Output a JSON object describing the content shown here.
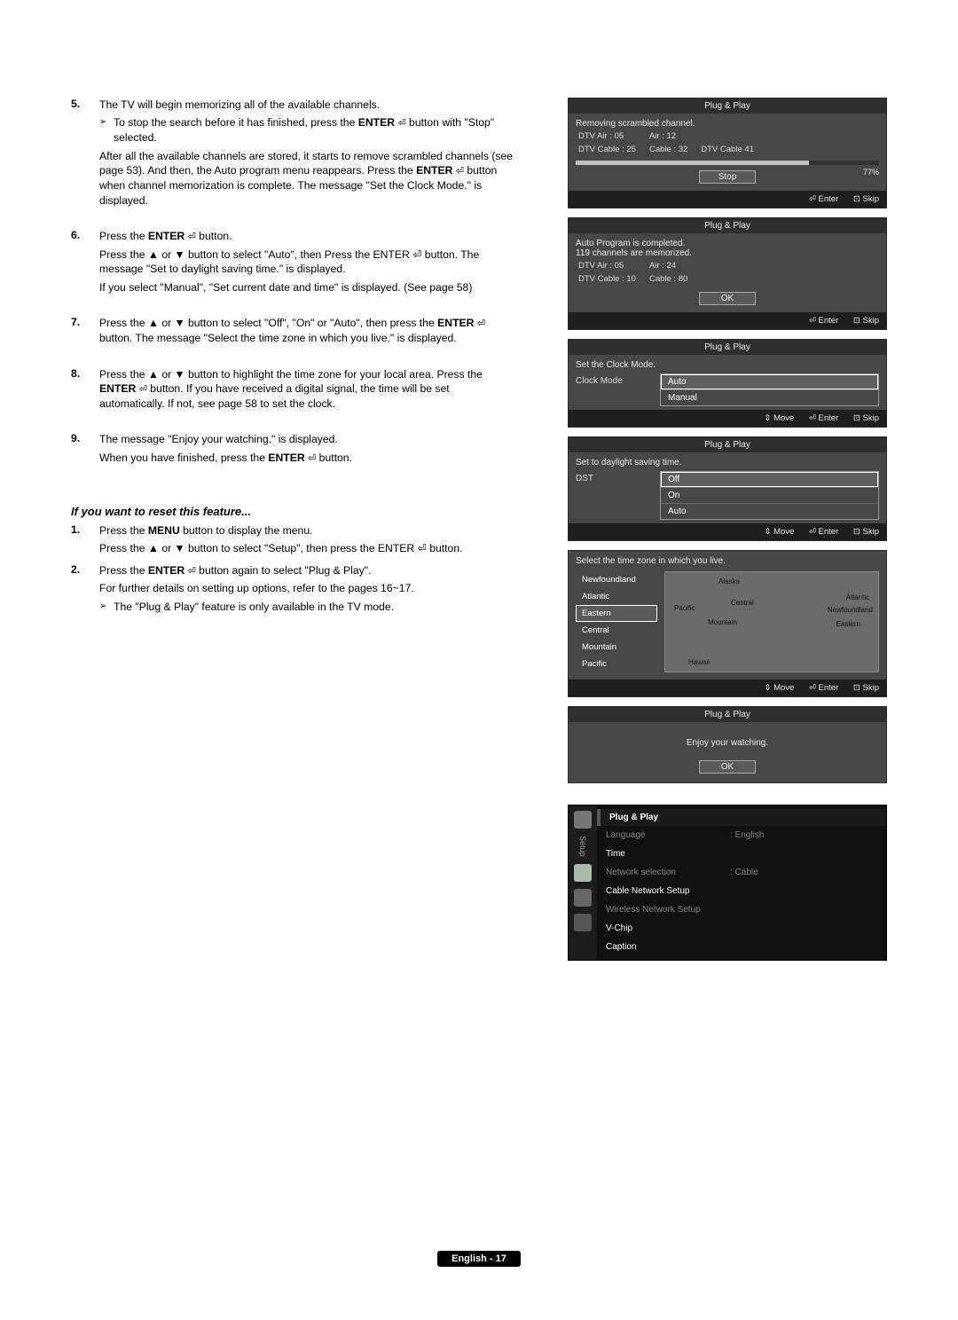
{
  "steps": {
    "s5": {
      "num": "5.",
      "p1a": "The TV will begin memorizing all of the available channels.",
      "note1a": "To stop the search before it has finished, press the ",
      "note1b": "ENTER",
      "note1c": " button with \"Stop\" selected.",
      "p2a": "After all the available channels are stored, it starts to remove scrambled channels (see page 53). And then, the Auto program menu reappears. Press the ",
      "p2b": "ENTER",
      "p2c": " button when channel memorization is complete. The message \"Set the Clock Mode.\" is displayed."
    },
    "s6": {
      "num": "6.",
      "p1a": "Press the ",
      "p1b": "ENTER",
      "p1c": " button.",
      "p2": "Press the ▲ or ▼ button to select \"Auto\", then Press the ENTER ⏎ button. The message \"Set to daylight saving time.\" is displayed.",
      "p3": "If you select \"Manual\", \"Set current date and time\" is displayed. (See page 58)"
    },
    "s7": {
      "num": "7.",
      "p1a": "Press the ▲ or ▼ button to select \"Off\", \"On\" or \"Auto\", then press the ",
      "p1b": "ENTER",
      "p1c": " button. The message \"Select the time zone in which you live.\" is displayed."
    },
    "s8": {
      "num": "8.",
      "p1a": "Press the ▲ or ▼ button to highlight the time zone for your local area. Press the ",
      "p1b": "ENTER",
      "p1c": " button. If you have received a digital signal, the time will be set automatically. If not, see page 58 to set the clock."
    },
    "s9": {
      "num": "9.",
      "p1": "The message \"Enjoy your watching.\" is displayed.",
      "p2a": "When you have finished, press the ",
      "p2b": "ENTER",
      "p2c": " button."
    }
  },
  "resetHeading": "If you want to reset this feature...",
  "reset": {
    "r1": {
      "num": "1.",
      "p1a": "Press the ",
      "p1b": "MENU",
      "p1c": " button to display the menu.",
      "p2": "Press the ▲ or ▼ button to select \"Setup\", then press the ENTER ⏎ button."
    },
    "r2": {
      "num": "2.",
      "p1a": "Press the ",
      "p1b": "ENTER",
      "p1c": " button again to select \"Plug & Play\".",
      "p2": "For further details on setting up options, refer to the pages 16~17.",
      "note": "The \"Plug & Play\" feature is only available in the TV mode."
    }
  },
  "enterGlyph": "⏎",
  "dlg1": {
    "title": "Plug & Play",
    "msg": "Removing scrambled channel.",
    "c1": "DTV Air : 05",
    "c2": "Air : 12",
    "c3": "DTV Cable : 25",
    "c4": "Cable : 32",
    "c5": "DTV Cable 41",
    "pct": "77%",
    "btn": "Stop",
    "hEnter": "⏎ Enter",
    "hSkip": "⊡ Skip"
  },
  "dlg2": {
    "title": "Plug & Play",
    "l1": "Auto Program is completed.",
    "l2": "119 channels are memorized.",
    "l3a": "DTV Air : 05",
    "l3b": "Air : 24",
    "l4a": "DTV Cable : 10",
    "l4b": "Cable : 80",
    "btn": "OK",
    "hEnter": "⏎ Enter",
    "hSkip": "⊡ Skip"
  },
  "dlg3": {
    "title": "Plug & Play",
    "msg": "Set the Clock Mode.",
    "label": "Clock Mode",
    "opt1": "Auto",
    "opt2": "Manual",
    "hMove": "⇕ Move",
    "hEnter": "⏎ Enter",
    "hSkip": "⊡ Skip"
  },
  "dlg4": {
    "title": "Plug & Play",
    "msg": "Set to daylight saving time.",
    "label": "DST",
    "opt1": "Off",
    "opt2": "On",
    "opt3": "Auto",
    "hMove": "⇕ Move",
    "hEnter": "⏎ Enter",
    "hSkip": "⊡ Skip"
  },
  "dlg5": {
    "msg": "Select the time zone in which you live.",
    "z1": "Newfoundland",
    "z2": "Atlantic",
    "z3": "Eastern",
    "z4": "Central",
    "z5": "Mountain",
    "z6": "Pacific",
    "m1": "Alaska",
    "m2": "Pacific",
    "m3": "Central",
    "m4": "Atlantic",
    "m5": "Mountain",
    "m6": "Eastern",
    "m7": "Newfoundland",
    "m8": "Hawaii",
    "hMove": "⇕ Move",
    "hEnter": "⏎ Enter",
    "hSkip": "⊡ Skip"
  },
  "dlg6": {
    "title": "Plug & Play",
    "msg": "Enjoy your watching.",
    "btn": "OK"
  },
  "setupMenu": {
    "tab": "Setup",
    "header": "Plug & Play",
    "r1k": "Language",
    "r1v": ": English",
    "r2k": "Time",
    "r3k": "Network selection",
    "r3v": ": Cable",
    "r4k": "Cable Network Setup",
    "r5k": "Wireless Network Setup",
    "r6k": "V-Chip",
    "r7k": "Caption"
  },
  "footer": "English - 17"
}
